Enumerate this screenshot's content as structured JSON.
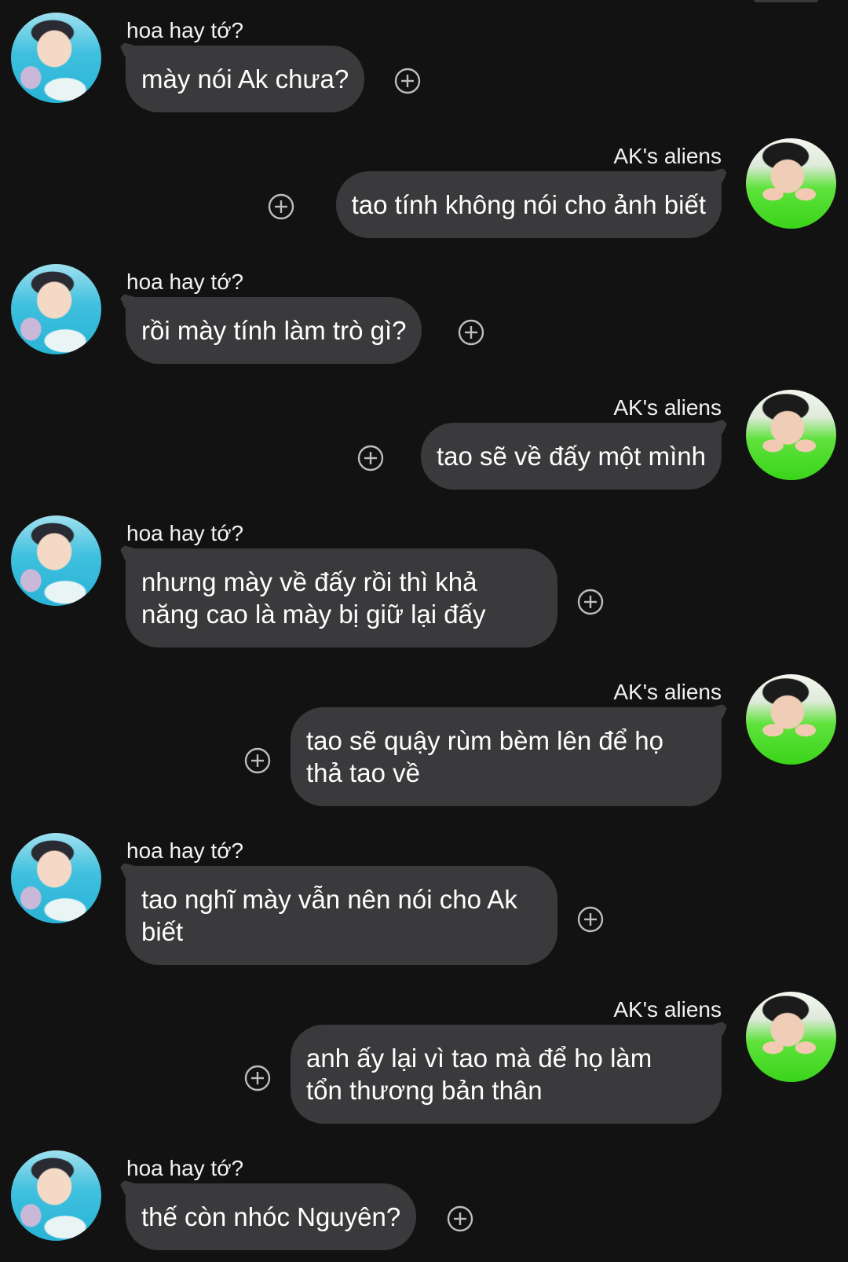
{
  "colors": {
    "background": "#121212",
    "bubble": "#3a3a3c",
    "text": "#ffffff",
    "icon": "#bdbdbd"
  },
  "icons": {
    "reaction": "add-reaction-icon",
    "avatar_left": "avatar-hoa-hay-to",
    "avatar_right": "avatar-aks-aliens"
  },
  "messages": [
    {
      "sender": "hoa hay tớ?",
      "side": "left",
      "lines": [
        "mày nói Ak chưa?"
      ]
    },
    {
      "sender": "AK's aliens",
      "side": "right",
      "lines": [
        "tao tính không nói cho ảnh biết"
      ]
    },
    {
      "sender": "hoa hay tớ?",
      "side": "left",
      "lines": [
        "rồi mày tính làm trò gì?"
      ]
    },
    {
      "sender": "AK's aliens",
      "side": "right",
      "lines": [
        "tao sẽ về đấy một mình"
      ]
    },
    {
      "sender": "hoa hay tớ?",
      "side": "left",
      "lines": [
        "nhưng mày về đấy rồi thì khả",
        "năng cao là mày bị giữ lại đấy"
      ]
    },
    {
      "sender": "AK's aliens",
      "side": "right",
      "lines": [
        "tao sẽ quậy rùm bèm lên để họ",
        "thả tao về"
      ]
    },
    {
      "sender": "hoa hay tớ?",
      "side": "left",
      "lines": [
        "tao nghĩ mày vẫn nên nói cho Ak",
        "biết"
      ]
    },
    {
      "sender": "AK's aliens",
      "side": "right",
      "lines": [
        "anh ấy lại vì tao mà để họ làm",
        "tổn thương bản thân"
      ]
    },
    {
      "sender": "hoa hay tớ?",
      "side": "left",
      "lines": [
        "thế còn nhóc Nguyên?"
      ]
    }
  ]
}
